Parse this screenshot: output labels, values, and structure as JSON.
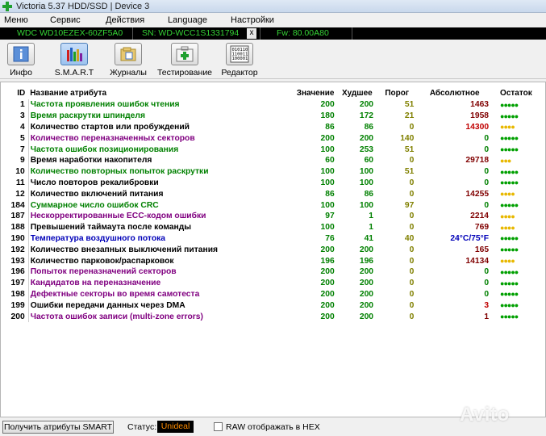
{
  "window": {
    "title": "Victoria 5.37 HDD/SSD | Device 3"
  },
  "menu": [
    "Меню",
    "Сервис",
    "Действия",
    "Language",
    "Настройки"
  ],
  "device": {
    "model": "WDC WD10EZEX-60ZF5A0",
    "serial": "SN: WD-WCC1S1331794",
    "close": "x",
    "firmware": "Fw: 80.00A80"
  },
  "toolbar": [
    {
      "label": "Инфо",
      "icon": "info-icon"
    },
    {
      "label": "S.M.A.R.T",
      "icon": "smart-chart-icon"
    },
    {
      "label": "Журналы",
      "icon": "journals-icon"
    },
    {
      "label": "Тестирование",
      "icon": "medkit-icon"
    },
    {
      "label": "Редактор",
      "icon": "binary-editor-icon"
    }
  ],
  "columns": [
    "ID",
    "Название атрибута",
    "Значение",
    "Худшее",
    "Порог",
    "Абсолютное",
    "Остаток"
  ],
  "rows": [
    {
      "id": "1",
      "name": "Частота проявления ошибок чтения",
      "value": "200",
      "worst": "200",
      "threshold": "51",
      "raw": "1463",
      "rest": "●●●●●",
      "name_color": "green",
      "raw_color": "darkred",
      "dots": "green"
    },
    {
      "id": "3",
      "name": "Время раскрутки шпинделя",
      "value": "180",
      "worst": "172",
      "threshold": "21",
      "raw": "1958",
      "rest": "●●●●●",
      "name_color": "green",
      "raw_color": "darkred",
      "dots": "green"
    },
    {
      "id": "4",
      "name": "Количество стартов или пробуждений",
      "value": "86",
      "worst": "86",
      "threshold": "0",
      "raw": "14300",
      "rest": "●●●●",
      "name_color": "black",
      "raw_color": "red",
      "dots": "yellow"
    },
    {
      "id": "5",
      "name": "Количество переназначенных секторов",
      "value": "200",
      "worst": "200",
      "threshold": "140",
      "raw": "0",
      "rest": "●●●●●",
      "name_color": "purple",
      "raw_color": "green",
      "dots": "green"
    },
    {
      "id": "7",
      "name": "Частота ошибок позиционирования",
      "value": "100",
      "worst": "253",
      "threshold": "51",
      "raw": "0",
      "rest": "●●●●●",
      "name_color": "green",
      "raw_color": "green",
      "dots": "green"
    },
    {
      "id": "9",
      "name": "Время наработки накопителя",
      "value": "60",
      "worst": "60",
      "threshold": "0",
      "raw": "29718",
      "rest": "●●●",
      "name_color": "black",
      "raw_color": "darkred",
      "dots": "yellow"
    },
    {
      "id": "10",
      "name": "Количество повторных попыток раскрутки",
      "value": "100",
      "worst": "100",
      "threshold": "51",
      "raw": "0",
      "rest": "●●●●●",
      "name_color": "green",
      "raw_color": "green",
      "dots": "green"
    },
    {
      "id": "11",
      "name": "Число повторов рекалибровки",
      "value": "100",
      "worst": "100",
      "threshold": "0",
      "raw": "0",
      "rest": "●●●●●",
      "name_color": "black",
      "raw_color": "green",
      "dots": "green"
    },
    {
      "id": "12",
      "name": "Количество включений питания",
      "value": "86",
      "worst": "86",
      "threshold": "0",
      "raw": "14255",
      "rest": "●●●●",
      "name_color": "black",
      "raw_color": "darkred",
      "dots": "yellow"
    },
    {
      "id": "184",
      "name": "Суммарное число ошибок CRC",
      "value": "100",
      "worst": "100",
      "threshold": "97",
      "raw": "0",
      "rest": "●●●●●",
      "name_color": "green",
      "raw_color": "green",
      "dots": "green"
    },
    {
      "id": "187",
      "name": "Нескорректированные ECC-кодом ошибки",
      "value": "97",
      "worst": "1",
      "threshold": "0",
      "raw": "2214",
      "rest": "●●●●",
      "name_color": "purple",
      "raw_color": "darkred",
      "dots": "yellow"
    },
    {
      "id": "188",
      "name": "Превышений таймаута после команды",
      "value": "100",
      "worst": "1",
      "threshold": "0",
      "raw": "769",
      "rest": "●●●●",
      "name_color": "black",
      "raw_color": "darkred",
      "dots": "yellow"
    },
    {
      "id": "190",
      "name": "Температура воздушного потока",
      "value": "76",
      "worst": "41",
      "threshold": "40",
      "raw": "24°C/75°F",
      "rest": "●●●●●",
      "name_color": "blue",
      "raw_color": "blue",
      "dots": "green"
    },
    {
      "id": "192",
      "name": "Количество внезапных выключений питания",
      "value": "200",
      "worst": "200",
      "threshold": "0",
      "raw": "165",
      "rest": "●●●●●",
      "name_color": "black",
      "raw_color": "darkred",
      "dots": "green"
    },
    {
      "id": "193",
      "name": "Количество парковок/распарковок",
      "value": "196",
      "worst": "196",
      "threshold": "0",
      "raw": "14134",
      "rest": "●●●●",
      "name_color": "black",
      "raw_color": "darkred",
      "dots": "yellow"
    },
    {
      "id": "196",
      "name": "Попыток переназначений секторов",
      "value": "200",
      "worst": "200",
      "threshold": "0",
      "raw": "0",
      "rest": "●●●●●",
      "name_color": "purple",
      "raw_color": "green",
      "dots": "green"
    },
    {
      "id": "197",
      "name": "Кандидатов на переназначение",
      "value": "200",
      "worst": "200",
      "threshold": "0",
      "raw": "0",
      "rest": "●●●●●",
      "name_color": "purple",
      "raw_color": "green",
      "dots": "green"
    },
    {
      "id": "198",
      "name": "Дефектные секторы во время самотеста",
      "value": "200",
      "worst": "200",
      "threshold": "0",
      "raw": "0",
      "rest": "●●●●●",
      "name_color": "purple",
      "raw_color": "green",
      "dots": "green"
    },
    {
      "id": "199",
      "name": "Ошибки передачи данных через DMA",
      "value": "200",
      "worst": "200",
      "threshold": "0",
      "raw": "3",
      "rest": "●●●●●",
      "name_color": "black",
      "raw_color": "red",
      "dots": "green"
    },
    {
      "id": "200",
      "name": "Частота ошибок записи (multi-zone errors)",
      "value": "200",
      "worst": "200",
      "threshold": "0",
      "raw": "1",
      "rest": "●●●●●",
      "name_color": "purple",
      "raw_color": "darkred",
      "dots": "green"
    }
  ],
  "statusbar": {
    "button": "Получить атрибуты SMART",
    "status_label": "Статус:",
    "status_value": "Unideal",
    "checkbox_label": "RAW отображать в HEX"
  },
  "watermark": "Avito",
  "colors": {
    "green": "#008000",
    "purple": "#800080",
    "blue": "#0000b8",
    "darkred": "#800000",
    "red": "#c00000",
    "status_orange": "#ff8c00",
    "device_bar_text": "#35d335"
  }
}
